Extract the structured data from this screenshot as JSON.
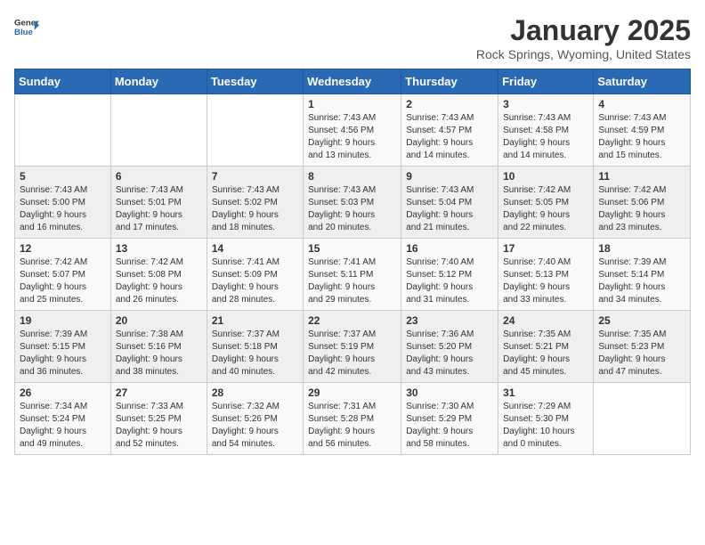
{
  "header": {
    "logo": {
      "general": "General",
      "blue": "Blue",
      "tagline": "GeneralBlue"
    },
    "title": "January 2025",
    "location": "Rock Springs, Wyoming, United States"
  },
  "weekdays": [
    "Sunday",
    "Monday",
    "Tuesday",
    "Wednesday",
    "Thursday",
    "Friday",
    "Saturday"
  ],
  "weeks": [
    [
      {
        "day": "",
        "info": ""
      },
      {
        "day": "",
        "info": ""
      },
      {
        "day": "",
        "info": ""
      },
      {
        "day": "1",
        "info": "Sunrise: 7:43 AM\nSunset: 4:56 PM\nDaylight: 9 hours\nand 13 minutes."
      },
      {
        "day": "2",
        "info": "Sunrise: 7:43 AM\nSunset: 4:57 PM\nDaylight: 9 hours\nand 14 minutes."
      },
      {
        "day": "3",
        "info": "Sunrise: 7:43 AM\nSunset: 4:58 PM\nDaylight: 9 hours\nand 14 minutes."
      },
      {
        "day": "4",
        "info": "Sunrise: 7:43 AM\nSunset: 4:59 PM\nDaylight: 9 hours\nand 15 minutes."
      }
    ],
    [
      {
        "day": "5",
        "info": "Sunrise: 7:43 AM\nSunset: 5:00 PM\nDaylight: 9 hours\nand 16 minutes."
      },
      {
        "day": "6",
        "info": "Sunrise: 7:43 AM\nSunset: 5:01 PM\nDaylight: 9 hours\nand 17 minutes."
      },
      {
        "day": "7",
        "info": "Sunrise: 7:43 AM\nSunset: 5:02 PM\nDaylight: 9 hours\nand 18 minutes."
      },
      {
        "day": "8",
        "info": "Sunrise: 7:43 AM\nSunset: 5:03 PM\nDaylight: 9 hours\nand 20 minutes."
      },
      {
        "day": "9",
        "info": "Sunrise: 7:43 AM\nSunset: 5:04 PM\nDaylight: 9 hours\nand 21 minutes."
      },
      {
        "day": "10",
        "info": "Sunrise: 7:42 AM\nSunset: 5:05 PM\nDaylight: 9 hours\nand 22 minutes."
      },
      {
        "day": "11",
        "info": "Sunrise: 7:42 AM\nSunset: 5:06 PM\nDaylight: 9 hours\nand 23 minutes."
      }
    ],
    [
      {
        "day": "12",
        "info": "Sunrise: 7:42 AM\nSunset: 5:07 PM\nDaylight: 9 hours\nand 25 minutes."
      },
      {
        "day": "13",
        "info": "Sunrise: 7:42 AM\nSunset: 5:08 PM\nDaylight: 9 hours\nand 26 minutes."
      },
      {
        "day": "14",
        "info": "Sunrise: 7:41 AM\nSunset: 5:09 PM\nDaylight: 9 hours\nand 28 minutes."
      },
      {
        "day": "15",
        "info": "Sunrise: 7:41 AM\nSunset: 5:11 PM\nDaylight: 9 hours\nand 29 minutes."
      },
      {
        "day": "16",
        "info": "Sunrise: 7:40 AM\nSunset: 5:12 PM\nDaylight: 9 hours\nand 31 minutes."
      },
      {
        "day": "17",
        "info": "Sunrise: 7:40 AM\nSunset: 5:13 PM\nDaylight: 9 hours\nand 33 minutes."
      },
      {
        "day": "18",
        "info": "Sunrise: 7:39 AM\nSunset: 5:14 PM\nDaylight: 9 hours\nand 34 minutes."
      }
    ],
    [
      {
        "day": "19",
        "info": "Sunrise: 7:39 AM\nSunset: 5:15 PM\nDaylight: 9 hours\nand 36 minutes."
      },
      {
        "day": "20",
        "info": "Sunrise: 7:38 AM\nSunset: 5:16 PM\nDaylight: 9 hours\nand 38 minutes."
      },
      {
        "day": "21",
        "info": "Sunrise: 7:37 AM\nSunset: 5:18 PM\nDaylight: 9 hours\nand 40 minutes."
      },
      {
        "day": "22",
        "info": "Sunrise: 7:37 AM\nSunset: 5:19 PM\nDaylight: 9 hours\nand 42 minutes."
      },
      {
        "day": "23",
        "info": "Sunrise: 7:36 AM\nSunset: 5:20 PM\nDaylight: 9 hours\nand 43 minutes."
      },
      {
        "day": "24",
        "info": "Sunrise: 7:35 AM\nSunset: 5:21 PM\nDaylight: 9 hours\nand 45 minutes."
      },
      {
        "day": "25",
        "info": "Sunrise: 7:35 AM\nSunset: 5:23 PM\nDaylight: 9 hours\nand 47 minutes."
      }
    ],
    [
      {
        "day": "26",
        "info": "Sunrise: 7:34 AM\nSunset: 5:24 PM\nDaylight: 9 hours\nand 49 minutes."
      },
      {
        "day": "27",
        "info": "Sunrise: 7:33 AM\nSunset: 5:25 PM\nDaylight: 9 hours\nand 52 minutes."
      },
      {
        "day": "28",
        "info": "Sunrise: 7:32 AM\nSunset: 5:26 PM\nDaylight: 9 hours\nand 54 minutes."
      },
      {
        "day": "29",
        "info": "Sunrise: 7:31 AM\nSunset: 5:28 PM\nDaylight: 9 hours\nand 56 minutes."
      },
      {
        "day": "30",
        "info": "Sunrise: 7:30 AM\nSunset: 5:29 PM\nDaylight: 9 hours\nand 58 minutes."
      },
      {
        "day": "31",
        "info": "Sunrise: 7:29 AM\nSunset: 5:30 PM\nDaylight: 10 hours\nand 0 minutes."
      },
      {
        "day": "",
        "info": ""
      }
    ]
  ]
}
